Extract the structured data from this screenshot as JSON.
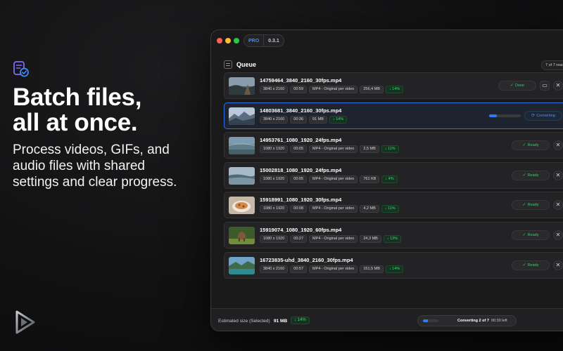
{
  "promo": {
    "headline_line1": "Batch files,",
    "headline_line2": "all at once.",
    "subtext": "Process videos, GIFs, and audio files with shared settings and clear progress."
  },
  "app": {
    "badge": "PRO",
    "version": "0.3.1",
    "queue_title": "Queue",
    "ready_count": "7 of 7 ready"
  },
  "colors": {
    "accent_blue": "#2f7bf5",
    "ready_green": "#45c46f",
    "savings_green": "#4ad37a"
  },
  "files": [
    {
      "name": "14759464_3840_2160_30fps.mp4",
      "resolution": "3840 x 2160",
      "duration": "00:59",
      "preset": "MP4 - Original per video",
      "size": "256,4 MB",
      "savings": "↓ 14%",
      "status": "Done",
      "progress": 1.0
    },
    {
      "name": "14803681_3840_2160_30fps.mp4",
      "resolution": "3840 x 2160",
      "duration": "00:36",
      "preset": "",
      "size": "91 MB",
      "savings": "↓ 14%",
      "status": "Converting",
      "progress": 0.25
    },
    {
      "name": "14953761_1080_1920_24fps.mp4",
      "resolution": "1080 x 1920",
      "duration": "00:05",
      "preset": "MP4 - Original per video",
      "size": "2,5 MB",
      "savings": "↓ 11%",
      "status": "Ready",
      "progress": 0
    },
    {
      "name": "15002818_1080_1920_24fps.mp4",
      "resolution": "1080 x 1920",
      "duration": "00:05",
      "preset": "MP4 - Original per video",
      "size": "761 KB",
      "savings": "↓ 4%",
      "status": "Ready",
      "progress": 0
    },
    {
      "name": "15918991_1080_1920_30fps.mp4",
      "resolution": "1080 x 1920",
      "duration": "00:08",
      "preset": "MP4 - Original per video",
      "size": "4,2 MB",
      "savings": "↓ 11%",
      "status": "Ready",
      "progress": 0
    },
    {
      "name": "15919074_1080_1920_60fps.mp4",
      "resolution": "1080 x 1920",
      "duration": "00:27",
      "preset": "MP4 - Original per video",
      "size": "24,3 MB",
      "savings": "↓ 13%",
      "status": "Ready",
      "progress": 0
    },
    {
      "name": "16723835-uhd_3840_2160_30fps.mp4",
      "resolution": "3840 x 2160",
      "duration": "00:57",
      "preset": "MP4 - Original per video",
      "size": "151,5 MB",
      "savings": "↓ 14%",
      "status": "Ready",
      "progress": 0
    }
  ],
  "footer": {
    "estimated_label": "Estimated size (Selected)",
    "estimated_value": "91 MB",
    "estimated_savings": "↓ 14%",
    "conversion_status": "Converting 2 of 7",
    "time_left": "00:30 left",
    "overall_progress": 0.3
  }
}
